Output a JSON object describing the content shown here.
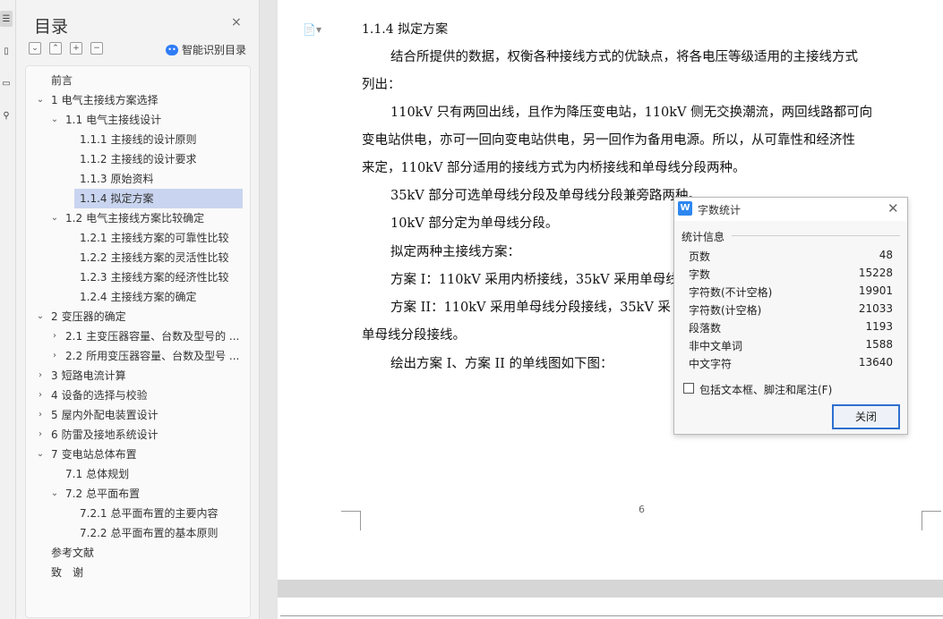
{
  "rail": {
    "icons": [
      "list-icon",
      "bookmark-icon",
      "page-icon",
      "search-icon"
    ]
  },
  "toc": {
    "title": "目录",
    "close": "×",
    "tools": [
      "⌄",
      "⌃",
      "+",
      "−"
    ],
    "smart_label": "智能识别目录",
    "items": [
      {
        "num": "",
        "label": "前言",
        "level": 0,
        "arrow": ""
      },
      {
        "num": "1",
        "label": "电气主接线方案选择",
        "level": 0,
        "arrow": "⌄"
      },
      {
        "num": "1.1",
        "label": "电气主接线设计",
        "level": 1,
        "arrow": "⌄"
      },
      {
        "num": "1.1.1",
        "label": "主接线的设计原则",
        "level": 2,
        "arrow": ""
      },
      {
        "num": "1.1.2",
        "label": "主接线的设计要求",
        "level": 2,
        "arrow": ""
      },
      {
        "num": "1.1.3",
        "label": "原始资料",
        "level": 2,
        "arrow": ""
      },
      {
        "num": "1.1.4",
        "label": "拟定方案",
        "level": 2,
        "arrow": "",
        "selected": true
      },
      {
        "num": "1.2",
        "label": "电气主接线方案比较确定",
        "level": 1,
        "arrow": "⌄"
      },
      {
        "num": "1.2.1",
        "label": "主接线方案的可靠性比较",
        "level": 2,
        "arrow": ""
      },
      {
        "num": "1.2.2",
        "label": "主接线方案的灵活性比较",
        "level": 2,
        "arrow": ""
      },
      {
        "num": "1.2.3",
        "label": "主接线方案的经济性比较",
        "level": 2,
        "arrow": ""
      },
      {
        "num": "1.2.4",
        "label": "主接线方案的确定",
        "level": 2,
        "arrow": ""
      },
      {
        "num": "2",
        "label": "变压器的确定",
        "level": 0,
        "arrow": "⌄"
      },
      {
        "num": "2.1",
        "label": "主变压器容量、台数及型号的 ...",
        "level": 1,
        "arrow": "›"
      },
      {
        "num": "2.2",
        "label": "所用变压器容量、台数及型号 ...",
        "level": 1,
        "arrow": "›"
      },
      {
        "num": "3",
        "label": "短路电流计算",
        "level": 0,
        "arrow": "›"
      },
      {
        "num": "4",
        "label": "设备的选择与校验",
        "level": 0,
        "arrow": "›"
      },
      {
        "num": "5",
        "label": "屋内外配电装置设计",
        "level": 0,
        "arrow": "›"
      },
      {
        "num": "6",
        "label": "防雷及接地系统设计",
        "level": 0,
        "arrow": "›"
      },
      {
        "num": "7",
        "label": "变电站总体布置",
        "level": 0,
        "arrow": "⌄"
      },
      {
        "num": "7.1",
        "label": "总体规划",
        "level": 1,
        "arrow": ""
      },
      {
        "num": "7.2",
        "label": "总平面布置",
        "level": 1,
        "arrow": "⌄"
      },
      {
        "num": "7.2.1",
        "label": "总平面布置的主要内容",
        "level": 2,
        "arrow": ""
      },
      {
        "num": "7.2.2",
        "label": "总平面布置的基本原则",
        "level": 2,
        "arrow": ""
      },
      {
        "num": "",
        "label": "参考文献",
        "level": 0,
        "arrow": ""
      },
      {
        "num": "",
        "label": "致　谢",
        "level": 0,
        "arrow": ""
      }
    ]
  },
  "document": {
    "para_icon": "📄▾",
    "heading": "1.1.4  拟定方案",
    "lines": [
      "结合所提供的数据，权衡各种接线方式的优缺点，将各电压等级适用的主接线方式",
      "列出：",
      "110kV 只有两回出线，且作为降压变电站，110kV 侧无交换潮流，两回线路都可向",
      "变电站供电，亦可一回向变电站供电，另一回作为备用电源。所以，从可靠性和经济性",
      "来定，110kV 部分适用的接线方式为内桥接线和单母线分段两种。",
      "35kV 部分可选单母线分段及单母线分段兼旁路两种。",
      "10kV 部分定为单母线分段。",
      "拟定两种主接线方案：",
      "方案 I：110kV 采用内桥接线，35kV 采用单母线",
      "方案 II：110kV 采用单母线分段接线，35kV 采",
      "单母线分段接线。",
      "绘出方案 I、方案 II 的单线图如下图："
    ],
    "page_number": "6"
  },
  "dialog": {
    "logo": "W",
    "title": "字数统计",
    "close": "✕",
    "section": "统计信息",
    "stats": [
      {
        "label": "页数",
        "value": "48"
      },
      {
        "label": "字数",
        "value": "15228"
      },
      {
        "label": "字符数(不计空格)",
        "value": "19901"
      },
      {
        "label": "字符数(计空格)",
        "value": "21033"
      },
      {
        "label": "段落数",
        "value": "1193"
      },
      {
        "label": "非中文单词",
        "value": "1588"
      },
      {
        "label": "中文字符",
        "value": "13640"
      }
    ],
    "checkbox_label": "包括文本框、脚注和尾注(F)",
    "checkbox_checked": false,
    "ok_label": "关闭"
  }
}
